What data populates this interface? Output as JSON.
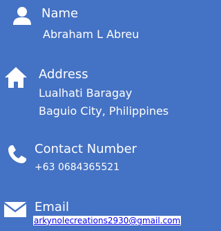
{
  "name": {
    "icon": "user-icon",
    "title": "Name",
    "value": "Abraham L Abreu"
  },
  "address": {
    "icon": "home-icon",
    "title": "Address",
    "line1": "Lualhati Baragay",
    "line2": "Baguio City, Philippines"
  },
  "contact": {
    "icon": "phone-icon",
    "title": "Contact Number",
    "value": "+63 0684365521"
  },
  "email": {
    "icon": "envelope-icon",
    "title": "Email",
    "value": "arkynolecreations2930@gmail.com"
  },
  "colors": {
    "background": "#4472c4",
    "text": "#ffffff",
    "link": "#0000ee"
  }
}
